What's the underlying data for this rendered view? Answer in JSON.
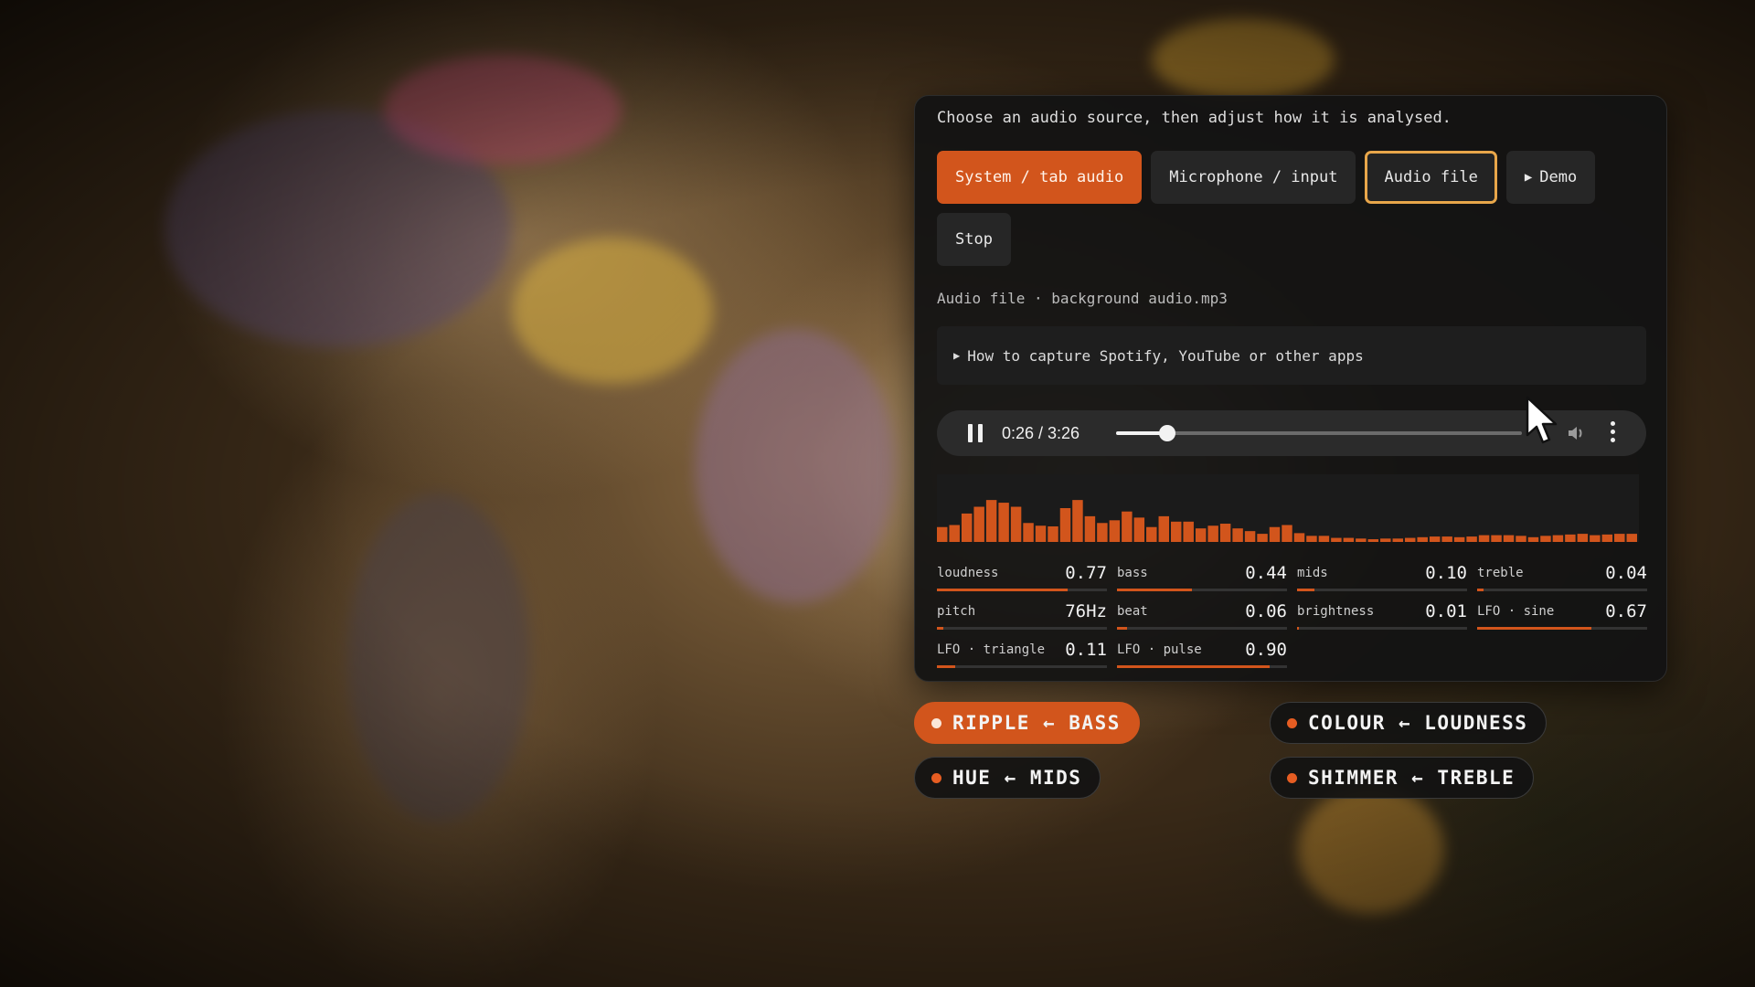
{
  "panel": {
    "intro": "Choose an audio source, then adjust how it is analysed.",
    "sources": [
      {
        "label": "System / tab audio",
        "state": "primary"
      },
      {
        "label": "Microphone / input",
        "state": "normal"
      },
      {
        "label": "Audio file",
        "state": "selected"
      },
      {
        "label": "Demo",
        "icon": "play-triangle-icon",
        "state": "normal"
      },
      {
        "label": "Stop",
        "state": "normal"
      }
    ],
    "status": "Audio file · background audio.mp3",
    "howto": "How to capture Spotify, YouTube or other apps",
    "player": {
      "time": "0:26 / 3:26",
      "progress": 0.126,
      "icons": [
        "pause-icon",
        "volume-icon",
        "more-vertical-icon"
      ]
    },
    "spectrum_levels": [
      0.22,
      0.25,
      0.42,
      0.52,
      0.62,
      0.58,
      0.52,
      0.28,
      0.24,
      0.23,
      0.5,
      0.62,
      0.38,
      0.28,
      0.32,
      0.45,
      0.36,
      0.22,
      0.38,
      0.3,
      0.3,
      0.2,
      0.24,
      0.27,
      0.2,
      0.16,
      0.12,
      0.22,
      0.25,
      0.13,
      0.09,
      0.09,
      0.06,
      0.06,
      0.05,
      0.04,
      0.05,
      0.05,
      0.06,
      0.07,
      0.08,
      0.08,
      0.07,
      0.08,
      0.1,
      0.1,
      0.1,
      0.09,
      0.07,
      0.09,
      0.1,
      0.11,
      0.12,
      0.1,
      0.11,
      0.12,
      0.12
    ],
    "meters": [
      {
        "label": "loudness",
        "value": "0.77",
        "level": 0.77
      },
      {
        "label": "bass",
        "value": "0.44",
        "level": 0.44
      },
      {
        "label": "mids",
        "value": "0.10",
        "level": 0.1
      },
      {
        "label": "treble",
        "value": "0.04",
        "level": 0.04
      },
      {
        "label": "pitch",
        "value": "76Hz",
        "level": 0.04
      },
      {
        "label": "beat",
        "value": "0.06",
        "level": 0.06
      },
      {
        "label": "brightness",
        "value": "0.01",
        "level": 0.01
      },
      {
        "label": "LFO · sine",
        "value": "0.67",
        "level": 0.67
      },
      {
        "label": "LFO · triangle",
        "value": "0.11",
        "level": 0.11
      },
      {
        "label": "LFO · pulse",
        "value": "0.90",
        "level": 0.9
      }
    ]
  },
  "mappings": [
    {
      "label": "RIPPLE ← BASS",
      "active": true
    },
    {
      "label": "COLOUR ← LOUDNESS",
      "active": false
    },
    {
      "label": "HUE ← MIDS",
      "active": false
    },
    {
      "label": "SHIMMER ← TREBLE",
      "active": false
    }
  ],
  "colors": {
    "accent": "#d2551c",
    "selected_border": "#e8a64a",
    "panel_bg": "#131313"
  }
}
